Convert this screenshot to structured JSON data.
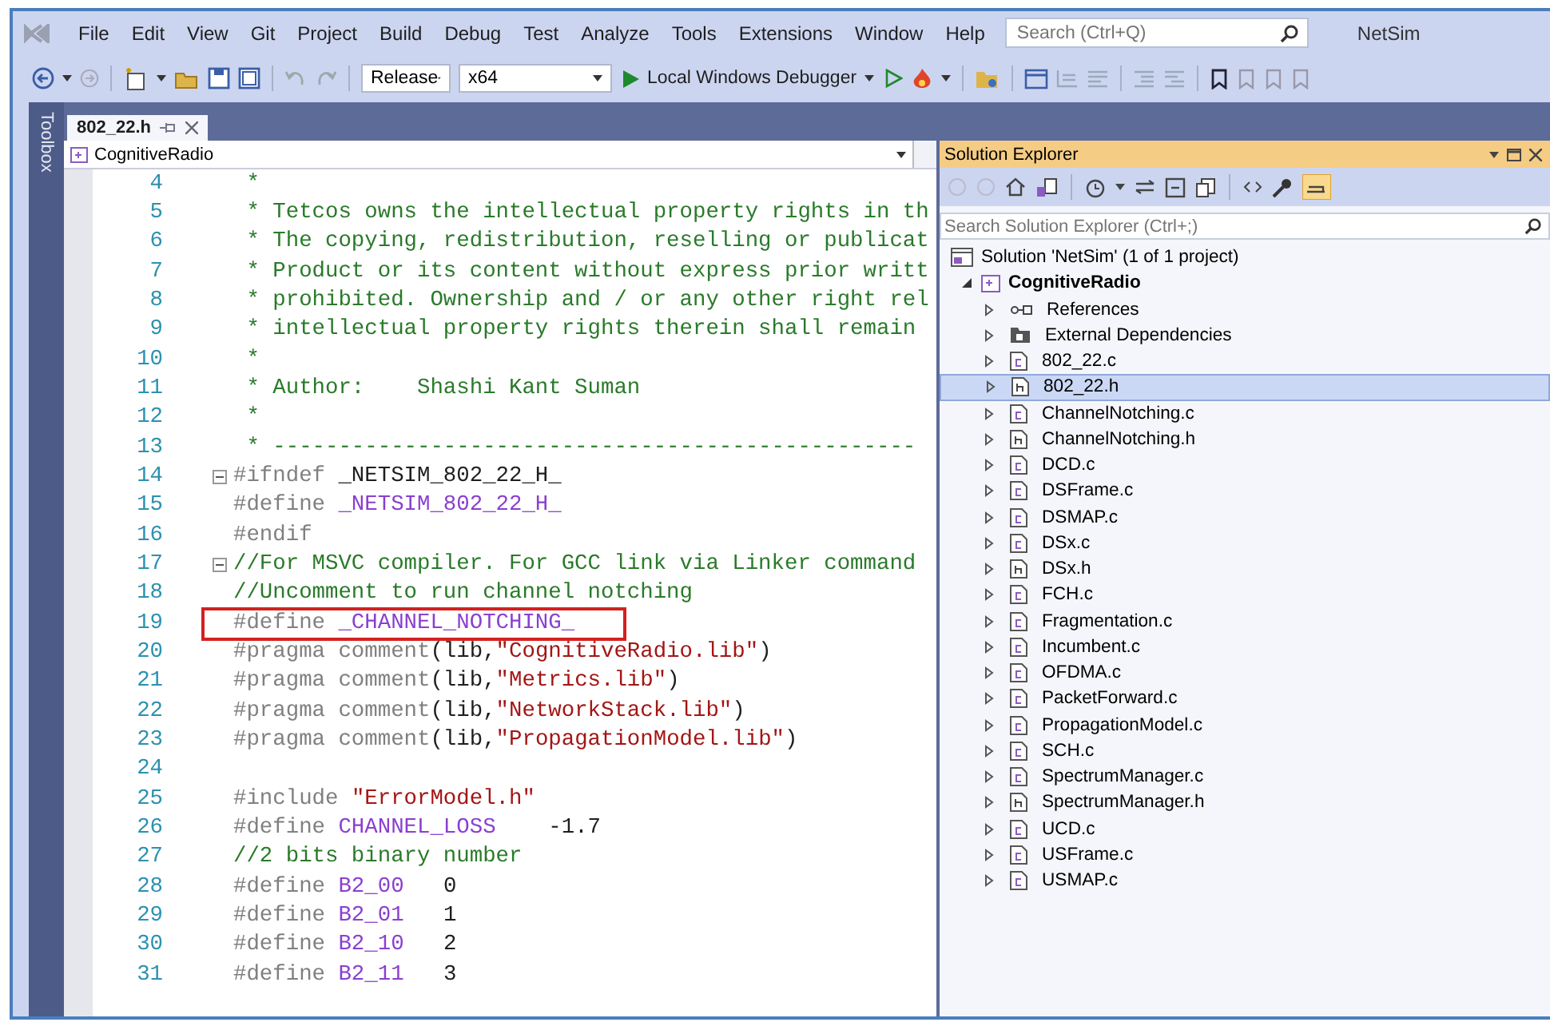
{
  "menu": {
    "items": [
      "File",
      "Edit",
      "View",
      "Git",
      "Project",
      "Build",
      "Debug",
      "Test",
      "Analyze",
      "Tools",
      "Extensions",
      "Window",
      "Help"
    ],
    "search": {
      "placeholder": "Search (Ctrl+Q)"
    },
    "solution_name": "NetSim"
  },
  "toolbar": {
    "configuration": "Release",
    "platform": "x64",
    "run_button": "Local Windows Debugger"
  },
  "toolbox": {
    "label": "Toolbox"
  },
  "editor": {
    "tabs": [
      {
        "label": "802_22.h",
        "selected": true
      }
    ],
    "navigation": "CognitiveRadio",
    "lines": [
      {
        "number": "4",
        "collapsible": false,
        "highlighted": false,
        "tokens": [
          {
            "kind": "comment",
            "text": " *"
          }
        ]
      },
      {
        "number": "5",
        "collapsible": false,
        "highlighted": false,
        "tokens": [
          {
            "kind": "comment",
            "text": " * Tetcos owns the intellectual property rights in th"
          }
        ]
      },
      {
        "number": "6",
        "collapsible": false,
        "highlighted": false,
        "tokens": [
          {
            "kind": "comment",
            "text": " * The copying, redistribution, reselling or publicat"
          }
        ]
      },
      {
        "number": "7",
        "collapsible": false,
        "highlighted": false,
        "tokens": [
          {
            "kind": "comment",
            "text": " * Product or its content without express prior writt"
          }
        ]
      },
      {
        "number": "8",
        "collapsible": false,
        "highlighted": false,
        "tokens": [
          {
            "kind": "comment",
            "text": " * prohibited. Ownership and / or any other right rel"
          }
        ]
      },
      {
        "number": "9",
        "collapsible": false,
        "highlighted": false,
        "tokens": [
          {
            "kind": "comment",
            "text": " * intellectual property rights therein shall remain"
          }
        ]
      },
      {
        "number": "10",
        "collapsible": false,
        "highlighted": false,
        "tokens": [
          {
            "kind": "comment",
            "text": " *"
          }
        ]
      },
      {
        "number": "11",
        "collapsible": false,
        "highlighted": false,
        "tokens": [
          {
            "kind": "comment",
            "text": " * Author:    Shashi Kant Suman"
          }
        ]
      },
      {
        "number": "12",
        "collapsible": false,
        "highlighted": false,
        "tokens": [
          {
            "kind": "comment",
            "text": " *"
          }
        ]
      },
      {
        "number": "13",
        "collapsible": false,
        "highlighted": false,
        "tokens": [
          {
            "kind": "comment",
            "text": " * -------------------------------------------------"
          }
        ]
      },
      {
        "number": "14",
        "collapsible": true,
        "highlighted": false,
        "tokens": [
          {
            "kind": "directive",
            "text": "#ifndef "
          },
          {
            "kind": "plain",
            "text": "_NETSIM_802_22_H_"
          }
        ]
      },
      {
        "number": "15",
        "collapsible": false,
        "highlighted": false,
        "tokens": [
          {
            "kind": "directive",
            "text": "#define "
          },
          {
            "kind": "macro",
            "text": "_NETSIM_802_22_H_"
          }
        ]
      },
      {
        "number": "16",
        "collapsible": false,
        "highlighted": false,
        "tokens": [
          {
            "kind": "directive",
            "text": "#endif"
          }
        ]
      },
      {
        "number": "17",
        "collapsible": true,
        "highlighted": false,
        "tokens": [
          {
            "kind": "comment",
            "text": "//For MSVC compiler. For GCC link via Linker command"
          }
        ]
      },
      {
        "number": "18",
        "collapsible": false,
        "highlighted": false,
        "tokens": [
          {
            "kind": "comment",
            "text": "//Uncomment to run channel notching"
          }
        ]
      },
      {
        "number": "19",
        "collapsible": false,
        "highlighted": true,
        "tokens": [
          {
            "kind": "directive",
            "text": "#define "
          },
          {
            "kind": "macro",
            "text": "_CHANNEL_NOTCHING_"
          }
        ]
      },
      {
        "number": "20",
        "collapsible": false,
        "highlighted": false,
        "tokens": [
          {
            "kind": "directive",
            "text": "#pragma comment"
          },
          {
            "kind": "plain",
            "text": "(lib,"
          },
          {
            "kind": "string",
            "text": "\"CognitiveRadio.lib\""
          },
          {
            "kind": "plain",
            "text": ")"
          }
        ]
      },
      {
        "number": "21",
        "collapsible": false,
        "highlighted": false,
        "tokens": [
          {
            "kind": "directive",
            "text": "#pragma comment"
          },
          {
            "kind": "plain",
            "text": "(lib,"
          },
          {
            "kind": "string",
            "text": "\"Metrics.lib\""
          },
          {
            "kind": "plain",
            "text": ")"
          }
        ]
      },
      {
        "number": "22",
        "collapsible": false,
        "highlighted": false,
        "tokens": [
          {
            "kind": "directive",
            "text": "#pragma comment"
          },
          {
            "kind": "plain",
            "text": "(lib,"
          },
          {
            "kind": "string",
            "text": "\"NetworkStack.lib\""
          },
          {
            "kind": "plain",
            "text": ")"
          }
        ]
      },
      {
        "number": "23",
        "collapsible": false,
        "highlighted": false,
        "tokens": [
          {
            "kind": "directive",
            "text": "#pragma comment"
          },
          {
            "kind": "plain",
            "text": "(lib,"
          },
          {
            "kind": "string",
            "text": "\"PropagationModel.lib\""
          },
          {
            "kind": "plain",
            "text": ")"
          }
        ]
      },
      {
        "number": "24",
        "collapsible": false,
        "highlighted": false
      },
      {
        "number": "25",
        "collapsible": false,
        "highlighted": false,
        "tokens": [
          {
            "kind": "directive",
            "text": "#include "
          },
          {
            "kind": "string",
            "text": "\"ErrorModel.h\""
          }
        ]
      },
      {
        "number": "26",
        "collapsible": false,
        "highlighted": false,
        "tokens": [
          {
            "kind": "directive",
            "text": "#define "
          },
          {
            "kind": "macro",
            "text": "CHANNEL_LOSS"
          },
          {
            "kind": "plain",
            "text": "    -1.7"
          }
        ]
      },
      {
        "number": "27",
        "collapsible": false,
        "highlighted": false,
        "tokens": [
          {
            "kind": "comment",
            "text": "//2 bits binary number"
          }
        ]
      },
      {
        "number": "28",
        "collapsible": false,
        "highlighted": false,
        "tokens": [
          {
            "kind": "directive",
            "text": "#define "
          },
          {
            "kind": "macro",
            "text": "B2_00"
          },
          {
            "kind": "plain",
            "text": "   0"
          }
        ]
      },
      {
        "number": "29",
        "collapsible": false,
        "highlighted": false,
        "tokens": [
          {
            "kind": "directive",
            "text": "#define "
          },
          {
            "kind": "macro",
            "text": "B2_01"
          },
          {
            "kind": "plain",
            "text": "   1"
          }
        ]
      },
      {
        "number": "30",
        "collapsible": false,
        "highlighted": false,
        "tokens": [
          {
            "kind": "directive",
            "text": "#define "
          },
          {
            "kind": "macro",
            "text": "B2_10"
          },
          {
            "kind": "plain",
            "text": "   2"
          }
        ]
      },
      {
        "number": "31",
        "collapsible": false,
        "highlighted": false,
        "tokens": [
          {
            "kind": "directive",
            "text": "#define "
          },
          {
            "kind": "macro",
            "text": "B2_11"
          },
          {
            "kind": "plain",
            "text": "   3"
          }
        ]
      }
    ]
  },
  "solution_explorer": {
    "title": "Solution Explorer",
    "search": {
      "placeholder": "Search Solution Explorer (Ctrl+;)"
    },
    "solution": {
      "label": "Solution 'NetSim' (1 of 1 project)",
      "children": [
        {
          "label": "CognitiveRadio",
          "kind": "project",
          "expanded": true,
          "selected": false,
          "children": [
            {
              "label": "References",
              "kind": "references",
              "expanded": false,
              "selected": false
            },
            {
              "label": "External Dependencies",
              "kind": "dependencies",
              "expanded": false,
              "selected": false
            },
            {
              "label": "802_22.c",
              "kind": "c-file",
              "expanded": false,
              "selected": false
            },
            {
              "label": "802_22.h",
              "kind": "h-file",
              "expanded": false,
              "selected": true
            },
            {
              "label": "ChannelNotching.c",
              "kind": "c-file",
              "expanded": false,
              "selected": false
            },
            {
              "label": "ChannelNotching.h",
              "kind": "h-file",
              "expanded": false,
              "selected": false
            },
            {
              "label": "DCD.c",
              "kind": "c-file",
              "expanded": false,
              "selected": false
            },
            {
              "label": "DSFrame.c",
              "kind": "c-file",
              "expanded": false,
              "selected": false
            },
            {
              "label": "DSMAP.c",
              "kind": "c-file",
              "expanded": false,
              "selected": false
            },
            {
              "label": "DSx.c",
              "kind": "c-file",
              "expanded": false,
              "selected": false
            },
            {
              "label": "DSx.h",
              "kind": "h-file",
              "expanded": false,
              "selected": false
            },
            {
              "label": "FCH.c",
              "kind": "c-file",
              "expanded": false,
              "selected": false
            },
            {
              "label": "Fragmentation.c",
              "kind": "c-file",
              "expanded": false,
              "selected": false
            },
            {
              "label": "Incumbent.c",
              "kind": "c-file",
              "expanded": false,
              "selected": false
            },
            {
              "label": "OFDMA.c",
              "kind": "c-file",
              "expanded": false,
              "selected": false
            },
            {
              "label": "PacketForward.c",
              "kind": "c-file",
              "expanded": false,
              "selected": false
            },
            {
              "label": "PropagationModel.c",
              "kind": "c-file",
              "expanded": false,
              "selected": false
            },
            {
              "label": "SCH.c",
              "kind": "c-file",
              "expanded": false,
              "selected": false
            },
            {
              "label": "SpectrumManager.c",
              "kind": "c-file",
              "expanded": false,
              "selected": false
            },
            {
              "label": "SpectrumManager.h",
              "kind": "h-file",
              "expanded": false,
              "selected": false
            },
            {
              "label": "UCD.c",
              "kind": "c-file",
              "expanded": false,
              "selected": false
            },
            {
              "label": "USFrame.c",
              "kind": "c-file",
              "expanded": false,
              "selected": false
            },
            {
              "label": "USMAP.c",
              "kind": "c-file",
              "expanded": false,
              "selected": false
            }
          ]
        }
      ]
    }
  }
}
